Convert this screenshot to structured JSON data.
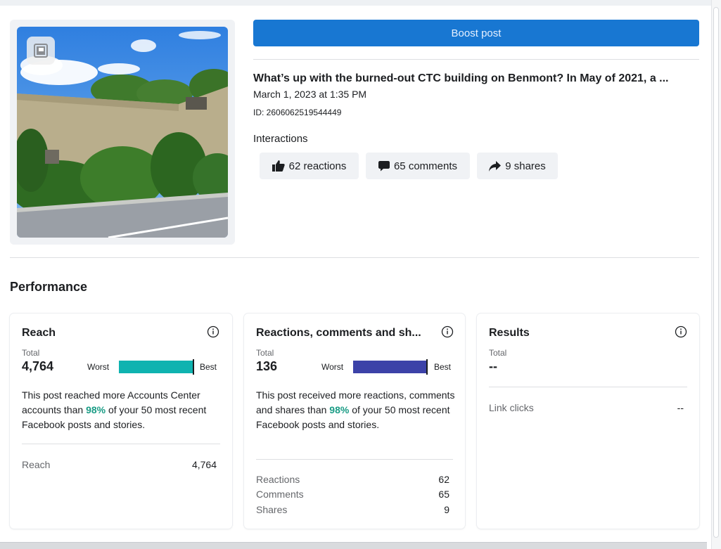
{
  "post": {
    "boost_label": "Boost post",
    "title": "What’s up with the burned-out CTC building on Benmont? In May of 2021, a ...",
    "date": "March 1, 2023 at 1:35 PM",
    "id": "ID: 2606062519544449",
    "interactions_label": "Interactions",
    "reactions": "62 reactions",
    "comments": "65 comments",
    "shares": "9 shares"
  },
  "performance": {
    "title": "Performance",
    "reach": {
      "title": "Reach",
      "total_label": "Total",
      "total_value": "4,764",
      "worst_label": "Worst",
      "best_label": "Best",
      "bar_fraction": 0.98,
      "bar_color": "#0fb3b0",
      "desc_before": "This post reached more Accounts Center accounts than ",
      "desc_pct": "98%",
      "desc_after": " of your 50 most recent Facebook posts and stories.",
      "rows": [
        {
          "label": "Reach",
          "value": "4,764"
        }
      ]
    },
    "engagement": {
      "title": "Reactions, comments and sh...",
      "total_label": "Total",
      "total_value": "136",
      "worst_label": "Worst",
      "best_label": "Best",
      "bar_fraction": 0.98,
      "bar_color": "#3c42a8",
      "desc_before": "This post received more reactions, comments and shares than ",
      "desc_pct": "98%",
      "desc_after": " of your 50 most recent Facebook posts and stories.",
      "rows": [
        {
          "label": "Reactions",
          "value": "62"
        },
        {
          "label": "Comments",
          "value": "65"
        },
        {
          "label": "Shares",
          "value": "9"
        }
      ]
    },
    "results": {
      "title": "Results",
      "total_label": "Total",
      "total_value": "--",
      "rows": [
        {
          "label": "Link clicks",
          "value": "--"
        }
      ]
    }
  },
  "colors": {
    "boost_button": "#1877d2",
    "highlight_pct": "#1a9c85"
  },
  "icons": {
    "photo_badge": "image-icon",
    "reactions": "thumbs-up-icon",
    "comments": "comment-icon",
    "shares": "share-arrow-icon",
    "info": "info-icon"
  }
}
